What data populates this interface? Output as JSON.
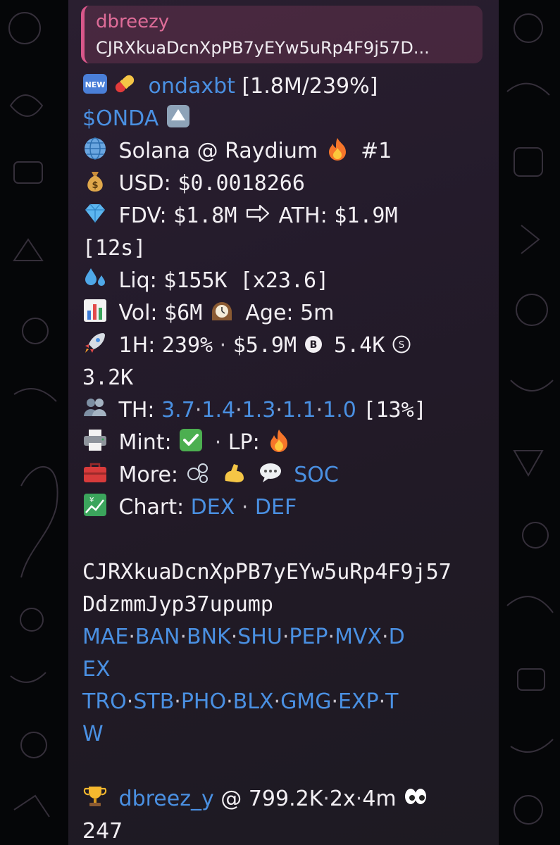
{
  "reply": {
    "name": "dbreezy",
    "text": "CJRXkuaDcnXpPB7yEYw5uRp4F9j57D..."
  },
  "header": {
    "new_badge": "NEW",
    "handle": "ondaxbt",
    "stats": "[1.8M/239%]",
    "ticker": "$ONDA"
  },
  "lines": {
    "chain": "Solana @ Raydium",
    "rank": "#1",
    "usd_label": "USD:",
    "usd_value": "$0.0018266",
    "fdv_label": "FDV:",
    "fdv_value": "$1.8M",
    "ath_label": "ATH:",
    "ath_value": "$1.9M",
    "ath_time": "[12s]",
    "liq_label": "Liq:",
    "liq_value": "$155K [x23.6]",
    "vol_label": "Vol:",
    "vol_value": "$6M",
    "age_label": "Age:",
    "age_value": "5m",
    "h1_label": "1H:",
    "h1_pct": "239%",
    "h1_sep": "·",
    "h1_vol": "$5.9M",
    "h1_buys": "5.4K",
    "h1_sells": "3.2K",
    "th_label": "TH:",
    "th_values": [
      "3.7",
      "1.4",
      "1.3",
      "1.1",
      "1.0"
    ],
    "th_total": "[13%]",
    "mint_label": "Mint:",
    "lp_label": "LP:",
    "more_label": "More:",
    "more_link": "SOC",
    "chart_label": "Chart:",
    "chart_links": [
      "DEX",
      "DEF"
    ]
  },
  "contract": {
    "line1": "CJRXkuaDcnXpPB7yEYw5uRp4F9j57",
    "line2": "DdzmmJyp37upump"
  },
  "bots": {
    "row1": [
      "MAE",
      "BAN",
      "BNK",
      "SHU",
      "PEP",
      "MVX",
      "D"
    ],
    "row1b": "EX",
    "row2": [
      "TRO",
      "STB",
      "PHO",
      "BLX",
      "GMG",
      "EXP",
      "T"
    ],
    "row2b": "W"
  },
  "footer": {
    "user": "dbreez_y",
    "at": "@ 799.2K",
    "mult": "2x",
    "time": "4m",
    "count": "247"
  },
  "icons": [
    "new-badge-icon",
    "pill-icon",
    "up-arrow-icon",
    "globe-icon",
    "fire-icon",
    "money-bag-icon",
    "gem-icon",
    "right-arrow-icon",
    "droplets-icon",
    "bar-chart-icon",
    "mantel-clock-icon",
    "rocket-icon",
    "b-circle-icon",
    "s-circle-icon",
    "people-icon",
    "printer-icon",
    "check-icon",
    "toolbox-icon",
    "bubbles-icon",
    "muscle-icon",
    "speech-icon",
    "chart-yen-icon",
    "trophy-icon",
    "eyes-icon"
  ],
  "colors": {
    "link": "#4a90e2",
    "reply_accent": "#d8578a",
    "text": "#f2eff3"
  }
}
